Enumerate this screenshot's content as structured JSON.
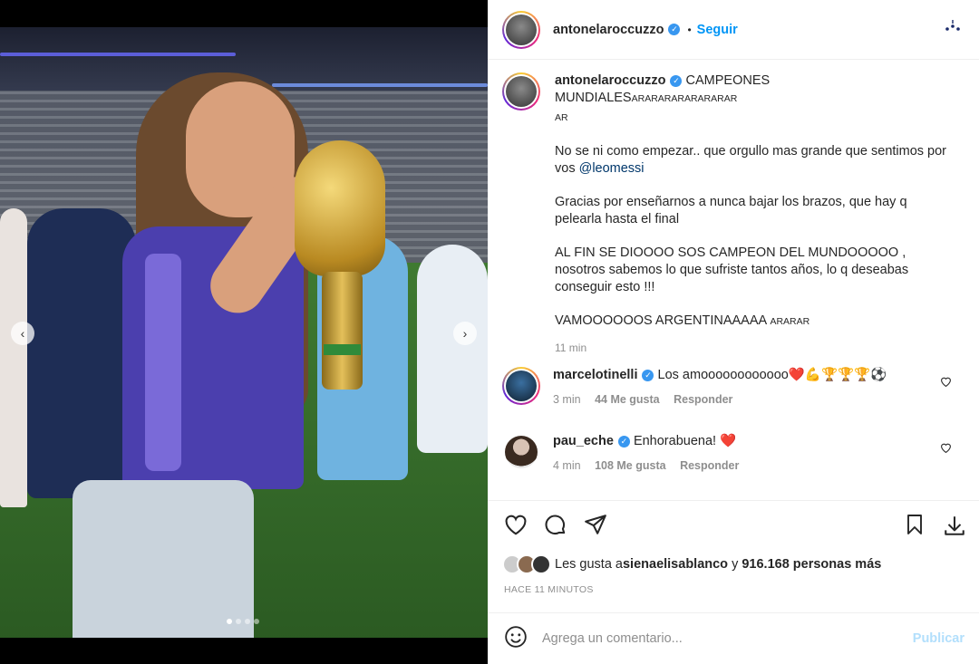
{
  "post": {
    "author": "antonelaroccuzzo",
    "follow_label": "Seguir",
    "separator": "•",
    "more_icon": "more-options-icon"
  },
  "caption": {
    "author": "antonelaroccuzzo",
    "title": "CAMPEONES MUNDIALES",
    "title_suffix": "ARARARARARARARAR",
    "title_suffix_end": "AR",
    "p1_text": "No se ni como empezar.. que orgullo mas grande que sentimos por vos ",
    "p1_mention": "@leomessi",
    "p2": "Gracias por enseñarnos a nunca bajar los brazos, que hay q pelearla hasta el final",
    "p3": "AL FIN SE DIOOOO SOS CAMPEON DEL MUNDOOOOO , nosotros sabemos lo que sufriste tantos años, lo q deseabas conseguir esto !!!",
    "p4_text": "VAMOOOOOOS ARGENTINAAAAA ",
    "p4_suffix": "ARARAR",
    "time": "11 min"
  },
  "comments": [
    {
      "author": "marcelotinelli",
      "text": "Los amoooooooooooo",
      "emojis": "❤️💪🏆🏆🏆⚽",
      "time": "3 min",
      "likes": "44 Me gusta",
      "reply": "Responder"
    },
    {
      "author": "pau_eche",
      "text": "Enhorabuena! ",
      "emojis": "❤️",
      "time": "4 min",
      "likes": "108 Me gusta",
      "reply": "Responder"
    }
  ],
  "likes": {
    "prefix": "Les gusta a ",
    "user": "sienaelisablanco",
    "middle": " y ",
    "count": "916.168 personas más"
  },
  "time_ago": "HACE 11 MINUTOS",
  "comment_box": {
    "placeholder": "Agrega un comentario...",
    "publish": "Publicar"
  },
  "media": {
    "prev_icon": "‹",
    "next_icon": "›",
    "slides": 4,
    "active_slide": 1
  },
  "colors": {
    "accent": "#0095f6",
    "verified": "#3897f0",
    "heart": "#ed4956",
    "publish_disabled": "#b2dffc"
  }
}
